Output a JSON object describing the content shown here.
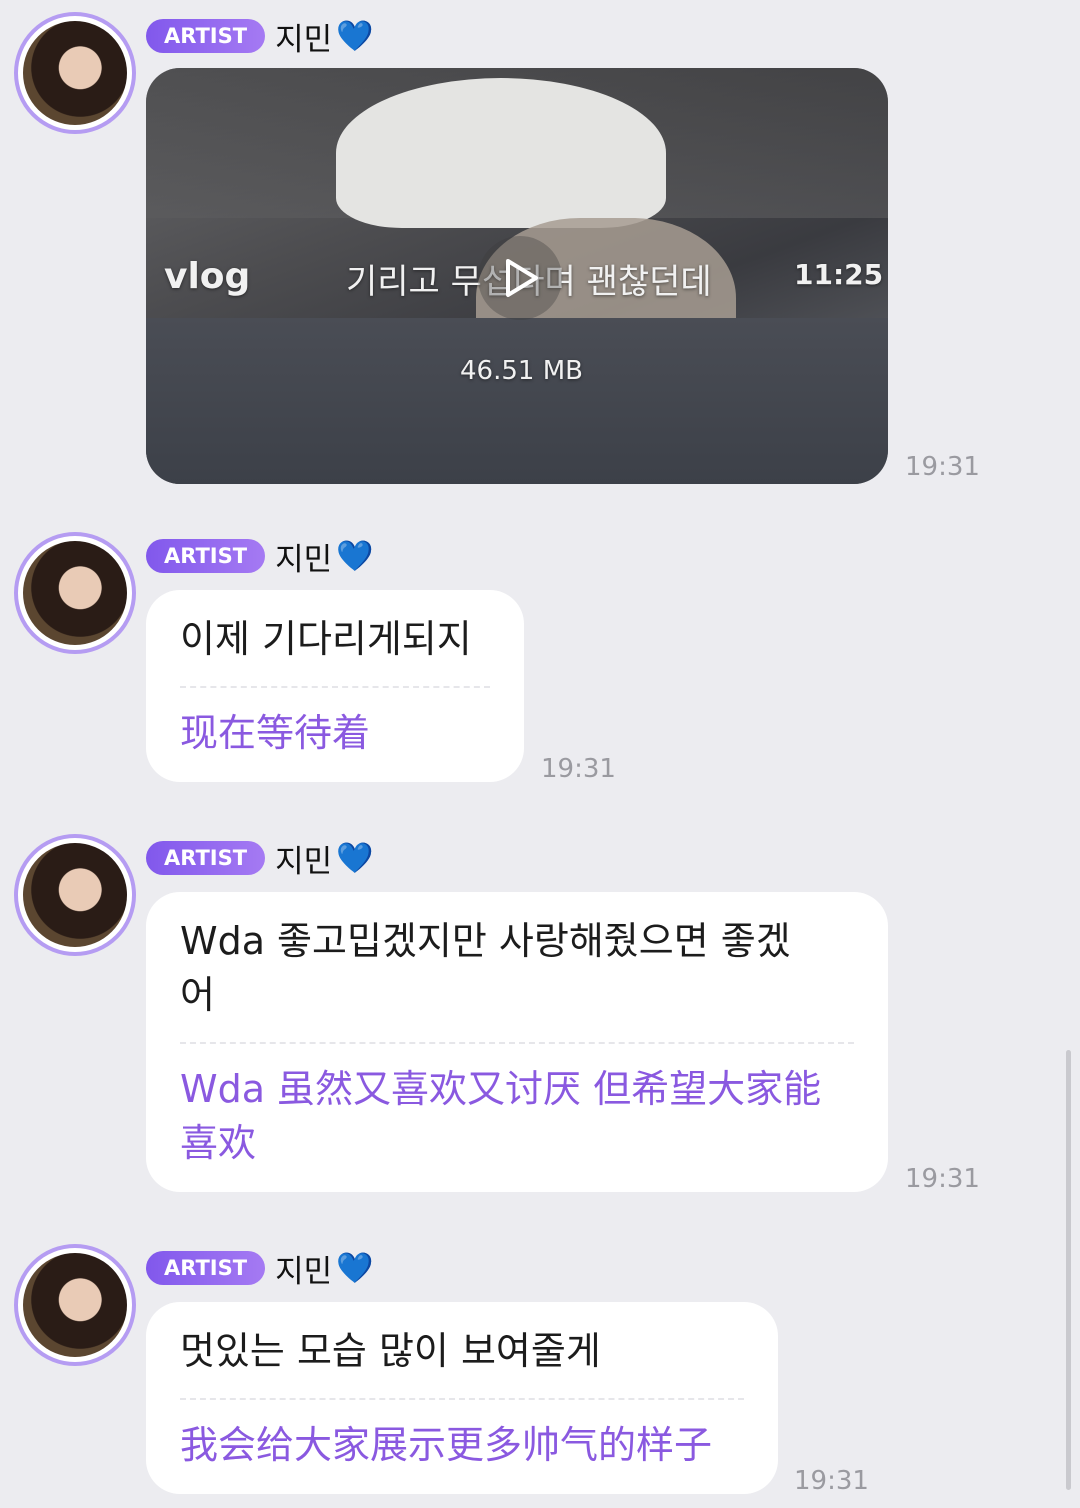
{
  "sender": {
    "badge": "ARTIST",
    "name": "지민",
    "heart": "💙"
  },
  "messages": [
    {
      "type": "video",
      "overlay_left": "vlog",
      "overlay_caption": "기리고 무섭다며 괜찮던데",
      "duration": "11:25",
      "size": "46.51 MB",
      "time": "19:31",
      "play_icon": "play-icon"
    },
    {
      "type": "text",
      "ko": "이제 기다리게되지",
      "zh": "现在等待着",
      "time": "19:31"
    },
    {
      "type": "text",
      "ko": "Wda 좋고밉겠지만 사랑해줬으면 좋겠\n어",
      "zh": "Wda 虽然又喜欢又讨厌 但希望大家能\n喜欢",
      "time": "19:31"
    },
    {
      "type": "text",
      "ko": "멋있는 모습 많이 보여줄게",
      "zh": "我会给大家展示更多帅气的样子",
      "time": "19:31"
    }
  ],
  "colors": {
    "background": "#ececf0",
    "badge": "#8a5cf0",
    "translation": "#8a59e0",
    "timestamp": "#9a9aa0"
  }
}
